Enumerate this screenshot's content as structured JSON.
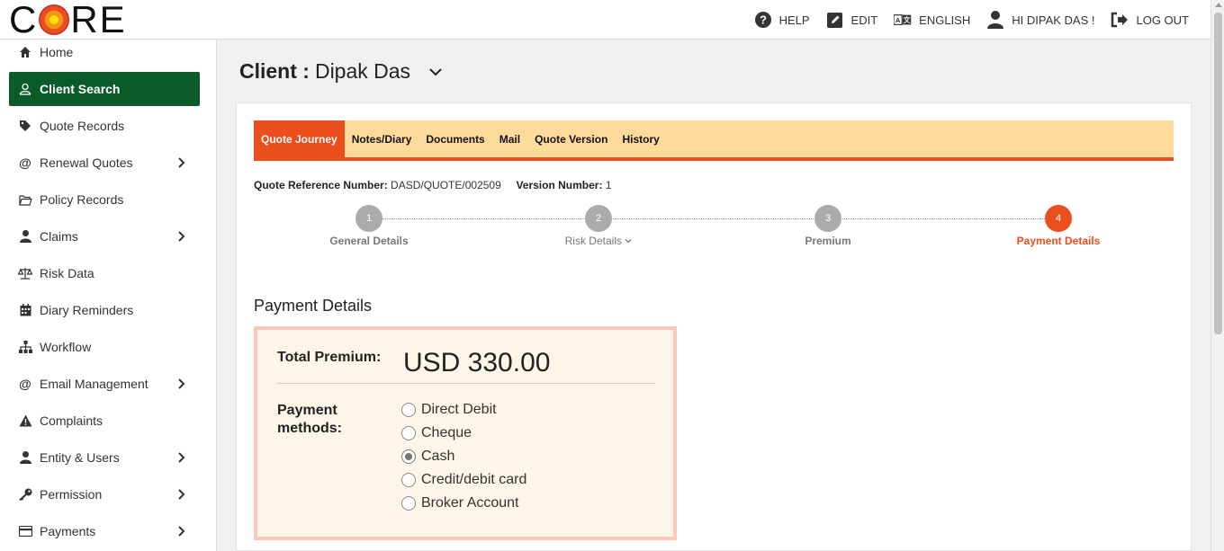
{
  "header": {
    "logo_text_left": "C",
    "logo_text_right": "RE",
    "nav": [
      {
        "label": "HELP",
        "icon": "help-circle-icon"
      },
      {
        "label": "EDIT",
        "icon": "edit-icon"
      },
      {
        "label": "ENGLISH",
        "icon": "translate-icon"
      },
      {
        "label": "HI DIPAK DAS !",
        "icon": "user-icon"
      },
      {
        "label": "LOG OUT",
        "icon": "logout-icon"
      }
    ]
  },
  "sidebar": {
    "items": [
      {
        "label": "Home",
        "icon": "home-icon",
        "has_children": false
      },
      {
        "label": "Client Search",
        "icon": "user-outline-icon",
        "has_children": false,
        "active": true
      },
      {
        "label": "Quote Records",
        "icon": "tag-icon",
        "has_children": false
      },
      {
        "label": "Renewal Quotes",
        "icon": "at-icon",
        "has_children": true
      },
      {
        "label": "Policy Records",
        "icon": "folder-open-icon",
        "has_children": false
      },
      {
        "label": "Claims",
        "icon": "user-icon",
        "has_children": true
      },
      {
        "label": "Risk Data",
        "icon": "balance-scale-icon",
        "has_children": false
      },
      {
        "label": "Diary Reminders",
        "icon": "calendar-icon",
        "has_children": false
      },
      {
        "label": "Workflow",
        "icon": "sitemap-icon",
        "has_children": false
      },
      {
        "label": "Email Management",
        "icon": "at-icon",
        "has_children": true
      },
      {
        "label": "Complaints",
        "icon": "warning-icon",
        "has_children": false
      },
      {
        "label": "Entity & Users",
        "icon": "user-icon",
        "has_children": true
      },
      {
        "label": "Permission",
        "icon": "key-icon",
        "has_children": true
      },
      {
        "label": "Payments",
        "icon": "credit-card-icon",
        "has_children": true
      }
    ]
  },
  "client": {
    "prefix": "Client :",
    "name": "Dipak Das"
  },
  "tabs": [
    {
      "label": "Quote Journey",
      "active": true
    },
    {
      "label": "Notes/Diary"
    },
    {
      "label": "Documents"
    },
    {
      "label": "Mail"
    },
    {
      "label": "Quote Version"
    },
    {
      "label": "History"
    }
  ],
  "quote": {
    "ref_label": "Quote Reference Number:",
    "ref_value": "DASD/QUOTE/002509",
    "version_label": "Version Number:",
    "version_value": "1"
  },
  "steps": [
    {
      "number": "1",
      "label": "General Details"
    },
    {
      "number": "2",
      "label": "Risk Details"
    },
    {
      "number": "3",
      "label": "Premium"
    },
    {
      "number": "4",
      "label": "Payment Details",
      "current": true
    }
  ],
  "payment": {
    "section_title": "Payment Details",
    "total_premium_label": "Total Premium:",
    "total_premium_value": "USD 330.00",
    "methods_label": "Payment methods:",
    "methods": [
      {
        "label": "Direct Debit",
        "checked": false
      },
      {
        "label": "Cheque",
        "checked": false
      },
      {
        "label": "Cash",
        "checked": true
      },
      {
        "label": "Credit/debit card",
        "checked": false
      },
      {
        "label": "Broker Account",
        "checked": false
      }
    ]
  },
  "colors": {
    "accent": "#e9501e",
    "tab_bar": "#ffdb9b",
    "sidebar_active": "#0b5a2a",
    "payment_box_bg": "#fdf5e8",
    "payment_box_border": "#fbc9b8"
  }
}
